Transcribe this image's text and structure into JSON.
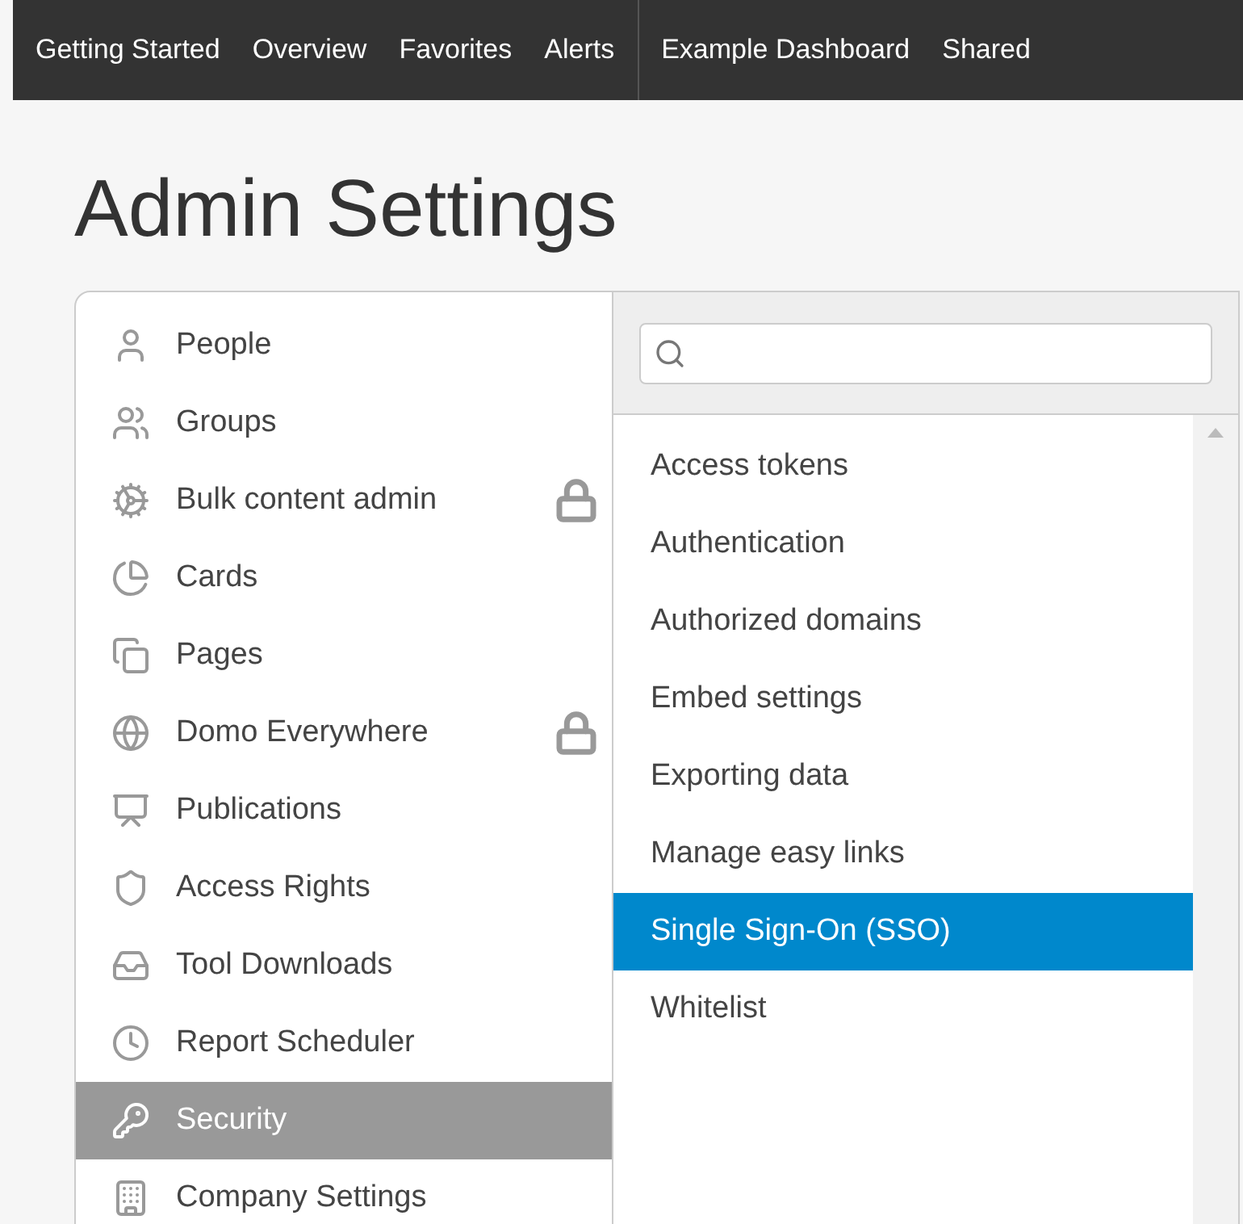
{
  "top_nav": {
    "groups": [
      {
        "items": [
          "Getting Started",
          "Overview",
          "Favorites",
          "Alerts"
        ]
      },
      {
        "items": [
          "Example Dashboard",
          "Shared"
        ]
      }
    ]
  },
  "page_title": "Admin Settings",
  "sidebar": {
    "items": [
      {
        "label": "People",
        "locked": false,
        "selected": false
      },
      {
        "label": "Groups",
        "locked": false,
        "selected": false
      },
      {
        "label": "Bulk content admin",
        "locked": true,
        "selected": false
      },
      {
        "label": "Cards",
        "locked": false,
        "selected": false
      },
      {
        "label": "Pages",
        "locked": false,
        "selected": false
      },
      {
        "label": "Domo Everywhere",
        "locked": true,
        "selected": false
      },
      {
        "label": "Publications",
        "locked": false,
        "selected": false
      },
      {
        "label": "Access Rights",
        "locked": false,
        "selected": false
      },
      {
        "label": "Tool Downloads",
        "locked": false,
        "selected": false
      },
      {
        "label": "Report Scheduler",
        "locked": false,
        "selected": false
      },
      {
        "label": "Security",
        "locked": false,
        "selected": true
      },
      {
        "label": "Company Settings",
        "locked": false,
        "selected": false
      }
    ]
  },
  "submenu": {
    "items": [
      {
        "label": "Access tokens",
        "selected": false
      },
      {
        "label": "Authentication",
        "selected": false
      },
      {
        "label": "Authorized domains",
        "selected": false
      },
      {
        "label": "Embed settings",
        "selected": false
      },
      {
        "label": "Exporting data",
        "selected": false
      },
      {
        "label": "Manage easy links",
        "selected": false
      },
      {
        "label": "Single Sign-On (SSO)",
        "selected": true
      },
      {
        "label": "Whitelist",
        "selected": false
      }
    ]
  }
}
